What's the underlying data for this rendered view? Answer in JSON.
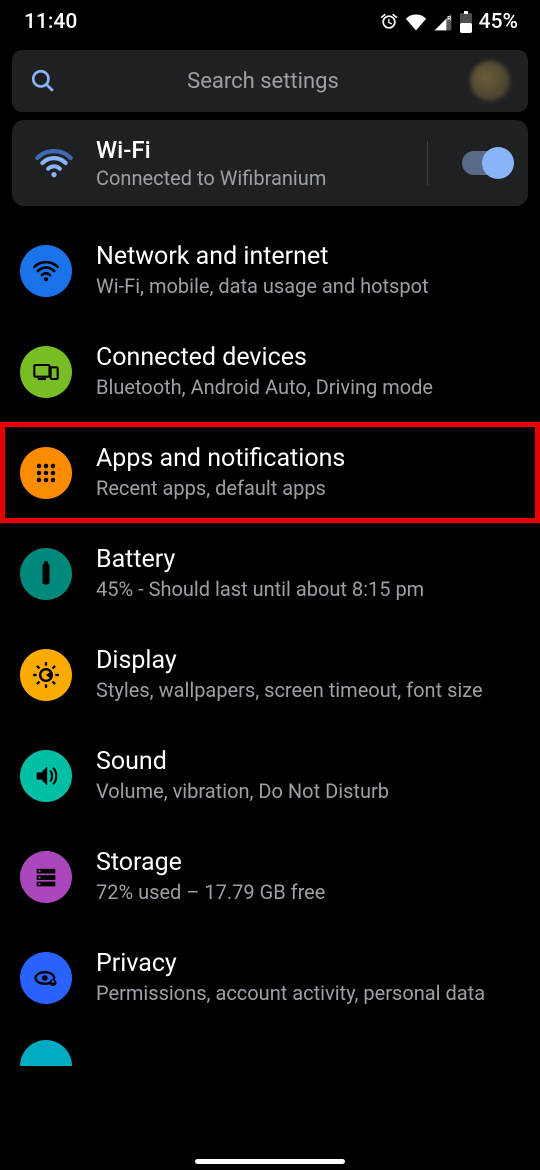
{
  "statusbar": {
    "time": "11:40",
    "battery_text": "45%"
  },
  "search": {
    "placeholder": "Search settings"
  },
  "wifi_card": {
    "title": "Wi-Fi",
    "subtitle": "Connected to Wifibranium",
    "toggle_on": true
  },
  "items": [
    {
      "title": "Network and internet",
      "subtitle": "Wi-Fi, mobile, data usage and hotspot",
      "icon": "wifi-icon",
      "color": "c-blue",
      "highlighted": false
    },
    {
      "title": "Connected devices",
      "subtitle": "Bluetooth, Android Auto, Driving mode",
      "icon": "devices-icon",
      "color": "c-green",
      "highlighted": false
    },
    {
      "title": "Apps and notifications",
      "subtitle": "Recent apps, default apps",
      "icon": "apps-icon",
      "color": "c-orange",
      "highlighted": true
    },
    {
      "title": "Battery",
      "subtitle": "45% - Should last until about 8:15 pm",
      "icon": "battery-icon",
      "color": "c-teal",
      "highlighted": false
    },
    {
      "title": "Display",
      "subtitle": "Styles, wallpapers, screen timeout, font size",
      "icon": "brightness-icon",
      "color": "c-amber",
      "highlighted": false
    },
    {
      "title": "Sound",
      "subtitle": "Volume, vibration, Do Not Disturb",
      "icon": "sound-icon",
      "color": "c-teal2",
      "highlighted": false
    },
    {
      "title": "Storage",
      "subtitle": "72% used – 17.79 GB free",
      "icon": "storage-icon",
      "color": "c-purple",
      "highlighted": false
    },
    {
      "title": "Privacy",
      "subtitle": "Permissions, account activity, personal data",
      "icon": "privacy-icon",
      "color": "c-blue2",
      "highlighted": false
    }
  ],
  "partial_item": {
    "title_fragment": "",
    "icon": "location-icon",
    "color": "c-cyan"
  }
}
